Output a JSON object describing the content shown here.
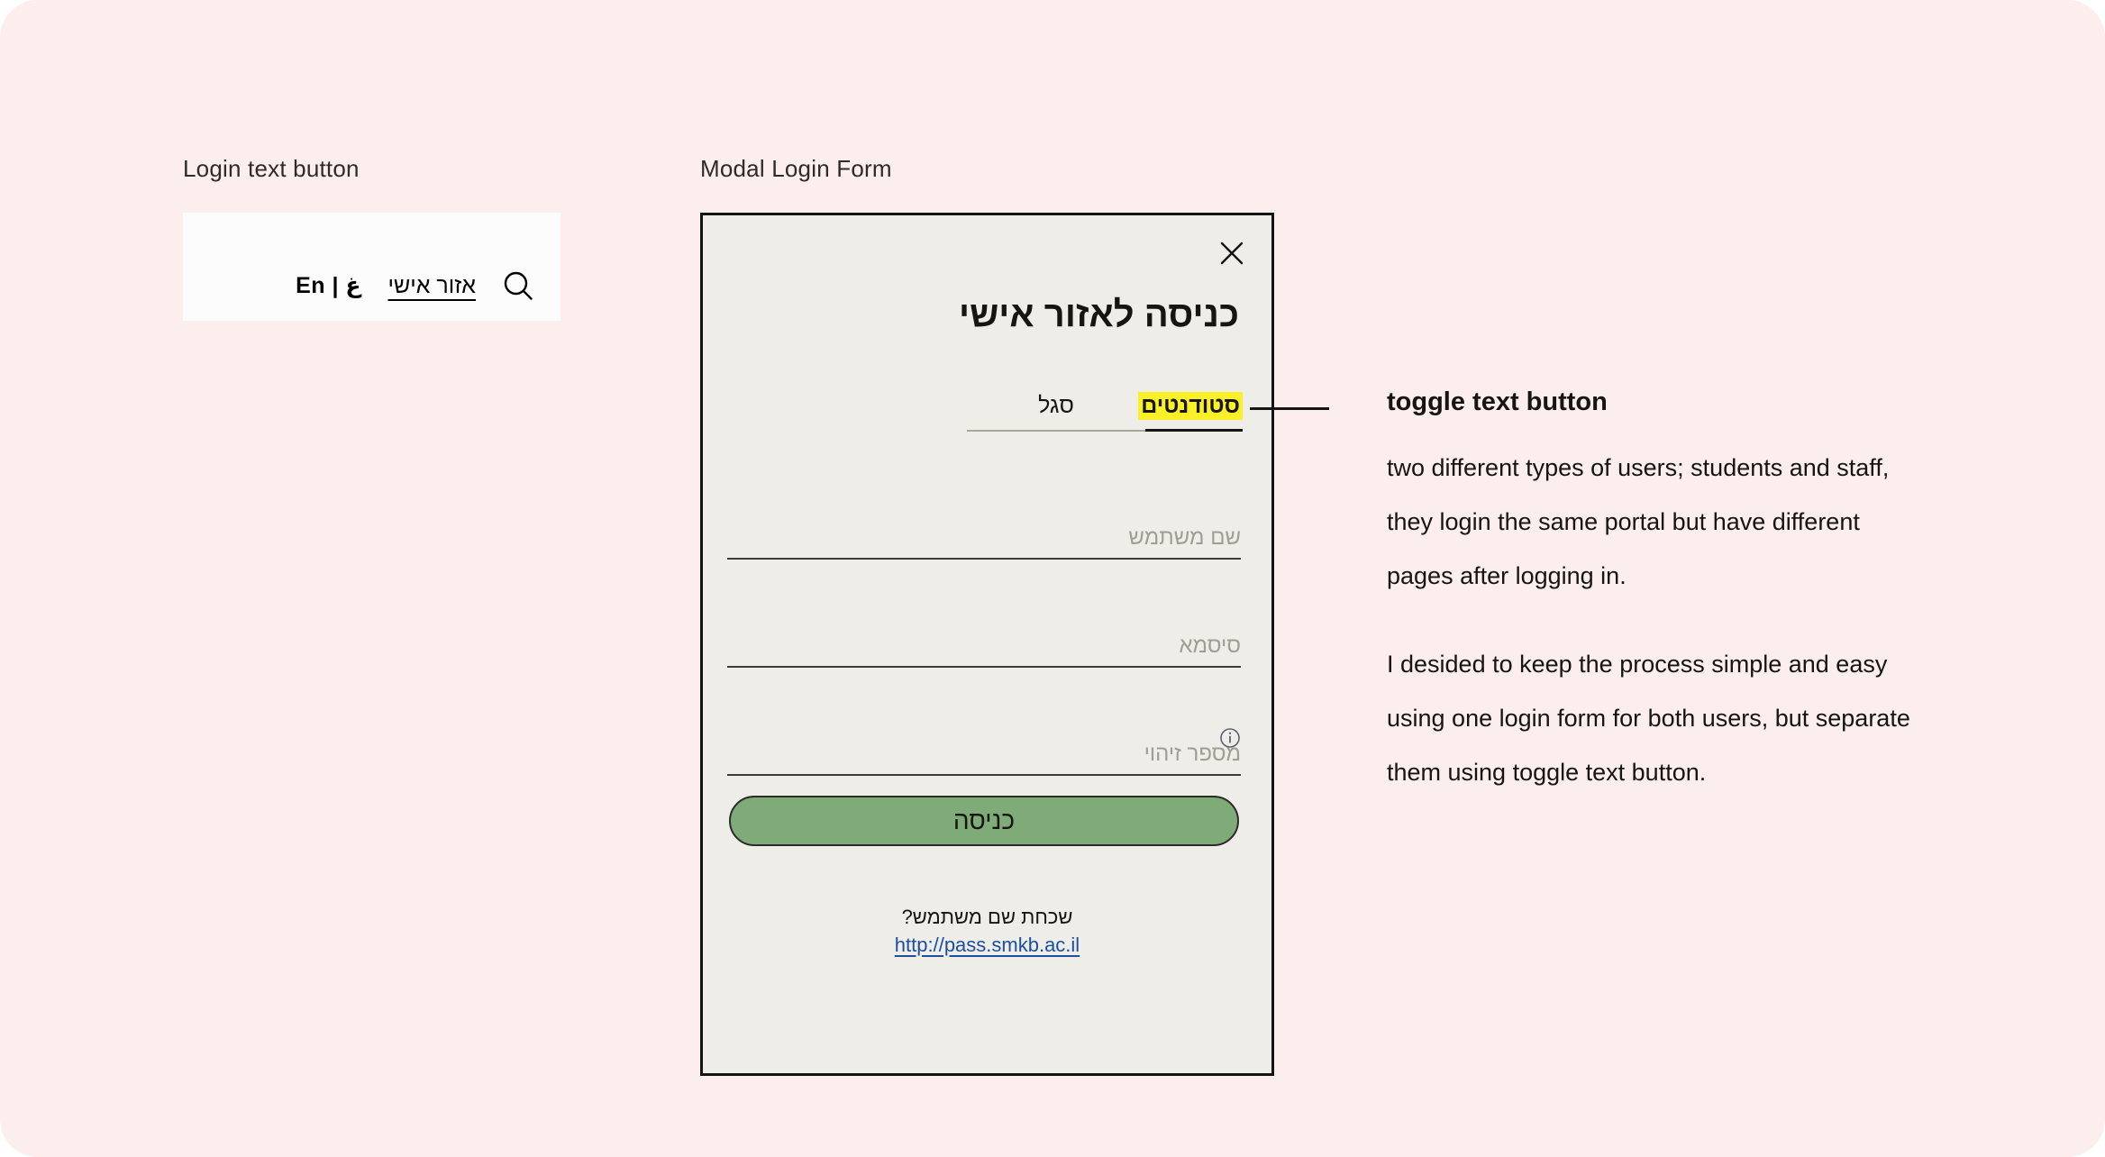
{
  "captions": {
    "login_button": "Login text button",
    "modal_form": "Modal Login Form"
  },
  "login_nav": {
    "search_icon": "search-icon",
    "personal_area_link": "אזור אישי",
    "language_switch": "En | غ"
  },
  "modal": {
    "close_icon": "close-icon",
    "title": "כניסה לאזור אישי",
    "tabs": [
      {
        "label": "סטודנטים",
        "active": true
      },
      {
        "label": "סגל",
        "active": false
      }
    ],
    "fields": [
      {
        "name": "username",
        "placeholder": "שם משתמש",
        "value": ""
      },
      {
        "name": "password",
        "placeholder": "סיסמא",
        "value": ""
      },
      {
        "name": "id-number",
        "placeholder": "מספר זיהוי",
        "value": ""
      }
    ],
    "info_icon": "info-circle-icon",
    "submit_label": "כניסה",
    "footer": {
      "forgot_text": "שכחת שם משתמש?",
      "reset_link": "http://pass.smkb.ac.il"
    }
  },
  "annotation": {
    "title": "toggle text button",
    "paragraph_1": "two different types of users; students and staff, they login the same portal but have different pages after logging in.",
    "paragraph_2": "I desided to keep the process simple and easy using one login form for both users, but separate them using toggle text button."
  },
  "colors": {
    "page_background": "#fbeeec",
    "card_background": "#fdfcfc",
    "modal_background": "#efede8",
    "modal_border": "#141414",
    "tab_highlight": "#faf027",
    "submit_button": "#7eab78",
    "link_blue": "#1b4fa0",
    "text": "#17150f"
  }
}
